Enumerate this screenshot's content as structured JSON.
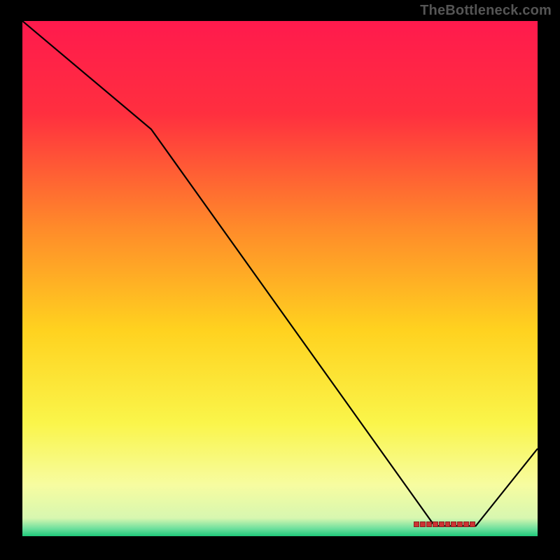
{
  "watermark": "TheBottleneck.com",
  "chart_data": {
    "type": "line",
    "title": "",
    "xlabel": "",
    "ylabel": "",
    "xlim": [
      0,
      100
    ],
    "ylim": [
      0,
      100
    ],
    "gradient_stops": [
      {
        "pos": 0.0,
        "color": "#ff1a4d"
      },
      {
        "pos": 0.18,
        "color": "#ff2f3f"
      },
      {
        "pos": 0.4,
        "color": "#ff8a2a"
      },
      {
        "pos": 0.6,
        "color": "#ffd21f"
      },
      {
        "pos": 0.78,
        "color": "#faf54a"
      },
      {
        "pos": 0.9,
        "color": "#f7fca0"
      },
      {
        "pos": 0.965,
        "color": "#d7f7b0"
      },
      {
        "pos": 0.985,
        "color": "#6fe09e"
      },
      {
        "pos": 1.0,
        "color": "#1fc97a"
      }
    ],
    "series": [
      {
        "name": "curve",
        "x": [
          0,
          25,
          80,
          88,
          100
        ],
        "y": [
          100,
          79,
          2,
          2,
          17
        ]
      }
    ],
    "marker_band": {
      "x_start": 76,
      "x_end": 88,
      "y": 2
    }
  }
}
